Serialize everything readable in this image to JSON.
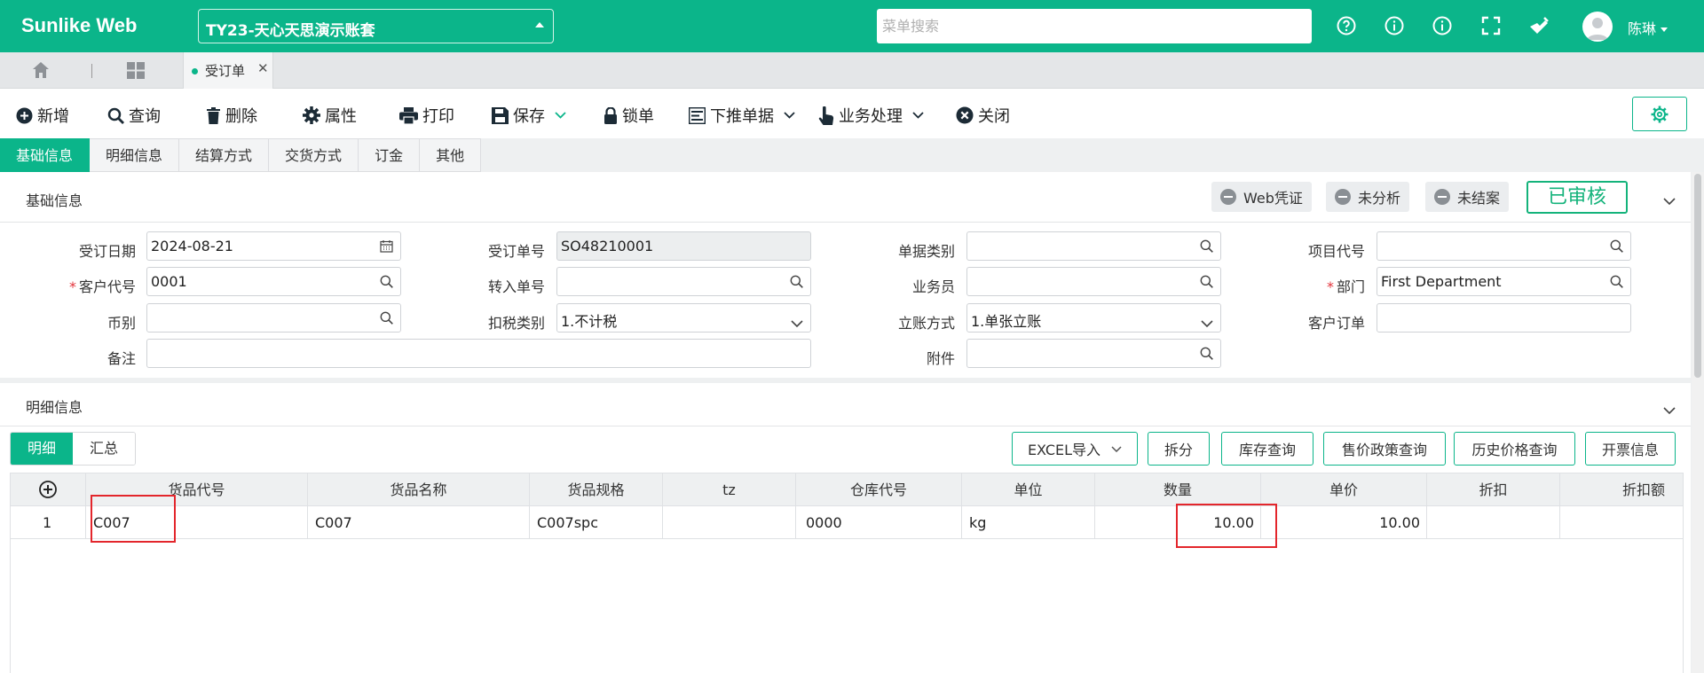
{
  "app": {
    "brand": "Sunlike Web",
    "account": "TY23-天心天思演示账套",
    "menu_search_placeholder": "菜单搜索",
    "user": "陈琳"
  },
  "tabs": {
    "active_doc": "受订单"
  },
  "toolbar": {
    "new": "新增",
    "query": "查询",
    "delete": "删除",
    "properties": "属性",
    "print": "打印",
    "save": "保存",
    "lock": "锁单",
    "push_down": "下推单据",
    "business": "业务处理",
    "close": "关闭"
  },
  "subtabs": [
    "基础信息",
    "明细信息",
    "结算方式",
    "交货方式",
    "订金",
    "其他"
  ],
  "basic": {
    "title": "基础信息",
    "badges": {
      "web_voucher": "Web凭证",
      "unanalyzed": "未分析",
      "unclosed": "未结案"
    },
    "status": "已审核",
    "fields": {
      "order_date": {
        "label": "受订日期",
        "value": "2024-08-21"
      },
      "order_no": {
        "label": "受订单号",
        "value": "SO48210001"
      },
      "doc_type": {
        "label": "单据类别",
        "value": ""
      },
      "project_code": {
        "label": "项目代号",
        "value": ""
      },
      "customer_code": {
        "label": "客户代号",
        "value": "0001"
      },
      "transfer_no": {
        "label": "转入单号",
        "value": ""
      },
      "salesperson": {
        "label": "业务员",
        "value": ""
      },
      "department": {
        "label": "部门",
        "value": "First Department"
      },
      "currency": {
        "label": "币别",
        "value": ""
      },
      "tax_type": {
        "label": "扣税类别",
        "value": "1.不计税"
      },
      "account_method": {
        "label": "立账方式",
        "value": "1.单张立账"
      },
      "customer_order": {
        "label": "客户订单",
        "value": ""
      },
      "remark": {
        "label": "备注",
        "value": ""
      },
      "attachment": {
        "label": "附件",
        "value": ""
      }
    }
  },
  "detail": {
    "title": "明细信息",
    "tabs": [
      "明细",
      "汇总"
    ],
    "buttons": {
      "excel_import": "EXCEL导入",
      "split": "拆分",
      "stock_query": "库存查询",
      "price_policy": "售价政策查询",
      "price_history": "历史价格查询",
      "invoice": "开票信息"
    },
    "columns": [
      "货品代号",
      "货品名称",
      "货品规格",
      "tz",
      "仓库代号",
      "单位",
      "数量",
      "单价",
      "折扣",
      "折扣额"
    ],
    "rows": [
      {
        "no": "1",
        "code": "C007",
        "name": "C007",
        "spec": "C007spc",
        "tz": "",
        "warehouse": "0000",
        "unit": "kg",
        "qty": "10.00",
        "price": "10.00",
        "discount": "",
        "discount_amt": ""
      }
    ]
  }
}
